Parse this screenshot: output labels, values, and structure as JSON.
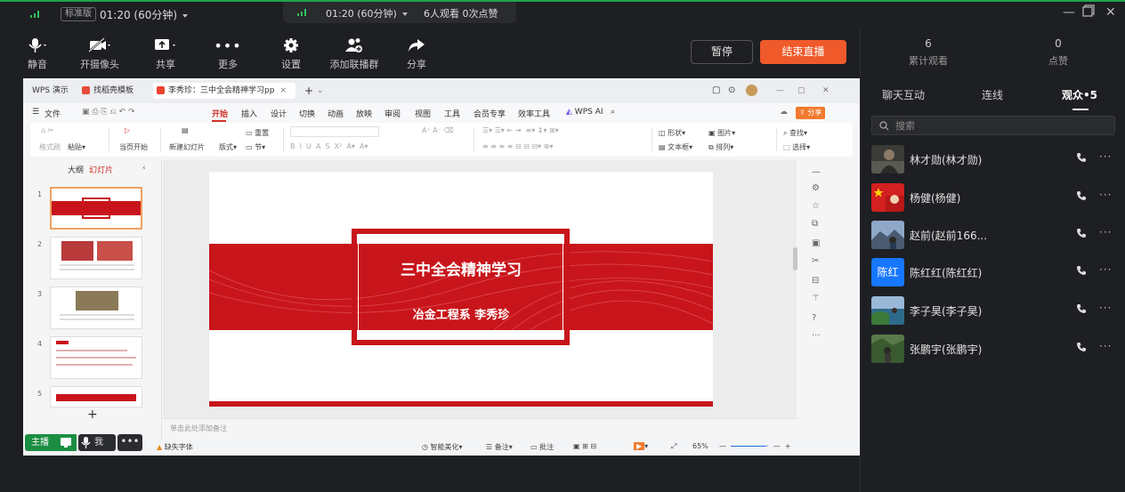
{
  "topbar": {
    "badge": "标准版",
    "time": "01:20 (60分钟)",
    "center_time": "01:20 (60分钟)",
    "center_stats": "6人观看 0次点赞"
  },
  "toolbar": {
    "mute": "静音",
    "camera": "开摄像头",
    "share": "共享",
    "more": "更多",
    "settings": "设置",
    "add_group": "添加联播群",
    "share_out": "分享",
    "pause": "暂停",
    "end_live": "结束直播"
  },
  "stats": {
    "views_count": "6",
    "views_label": "累计观看",
    "likes_count": "0",
    "likes_label": "点赞"
  },
  "right_tabs": [
    "聊天互动",
    "连线",
    "观众•5"
  ],
  "search": {
    "placeholder": "搜索"
  },
  "viewers": [
    {
      "name": "林才勋(林才勋)",
      "avatar": "photo-dark"
    },
    {
      "name": "杨健(杨健)",
      "avatar": "flag-red"
    },
    {
      "name": "赵前(赵前166...",
      "avatar": "photo-mountain"
    },
    {
      "name": "陈红红(陈红红)",
      "avatar": "text-blue",
      "avatar_text": "陈红"
    },
    {
      "name": "李子昊(李子昊)",
      "avatar": "photo-coast"
    },
    {
      "name": "张鹏宇(张鹏宇)",
      "avatar": "photo-green"
    }
  ],
  "wps": {
    "tab_home": "WPS 演示",
    "tab_template": "找稻壳模板",
    "tab_doc": "李秀珍：三中全会精神学习pp",
    "menu": [
      "文件",
      "开始",
      "插入",
      "设计",
      "切换",
      "动画",
      "放映",
      "审阅",
      "视图",
      "工具",
      "会员专享",
      "效率工具"
    ],
    "wps_ai": "WPS AI",
    "share": "分享",
    "ribbon": {
      "format_painter": "格式刷",
      "paste": "粘贴",
      "start_slide": "当页开始",
      "new_slide": "新建幻灯片",
      "layout": "版式",
      "section": "节",
      "reset": "重置",
      "shape": "形状",
      "picture": "图片",
      "textbox": "文本框",
      "arrange": "排列",
      "find": "查找",
      "select": "选择"
    },
    "left_tabs": {
      "outline": "大纲",
      "slides": "幻灯片"
    },
    "slide_numbers": [
      "1",
      "2",
      "3",
      "4",
      "5"
    ],
    "slide": {
      "title": "三中全会精神学习",
      "subtitle": "冶金工程系   李秀珍"
    },
    "notes_placeholder": "单击此处添加备注",
    "status": {
      "missing_font": "缺失字体",
      "beautify": "智能美化",
      "notes": "备注",
      "comments": "批注",
      "zoom": "65%"
    }
  },
  "hostbar": {
    "host": "主播",
    "me": "我"
  },
  "colors": {
    "accent_green": "#1fa34a",
    "end_button": "#f05a2a",
    "slide_red": "#c8151b",
    "background": "#1e1f22"
  }
}
